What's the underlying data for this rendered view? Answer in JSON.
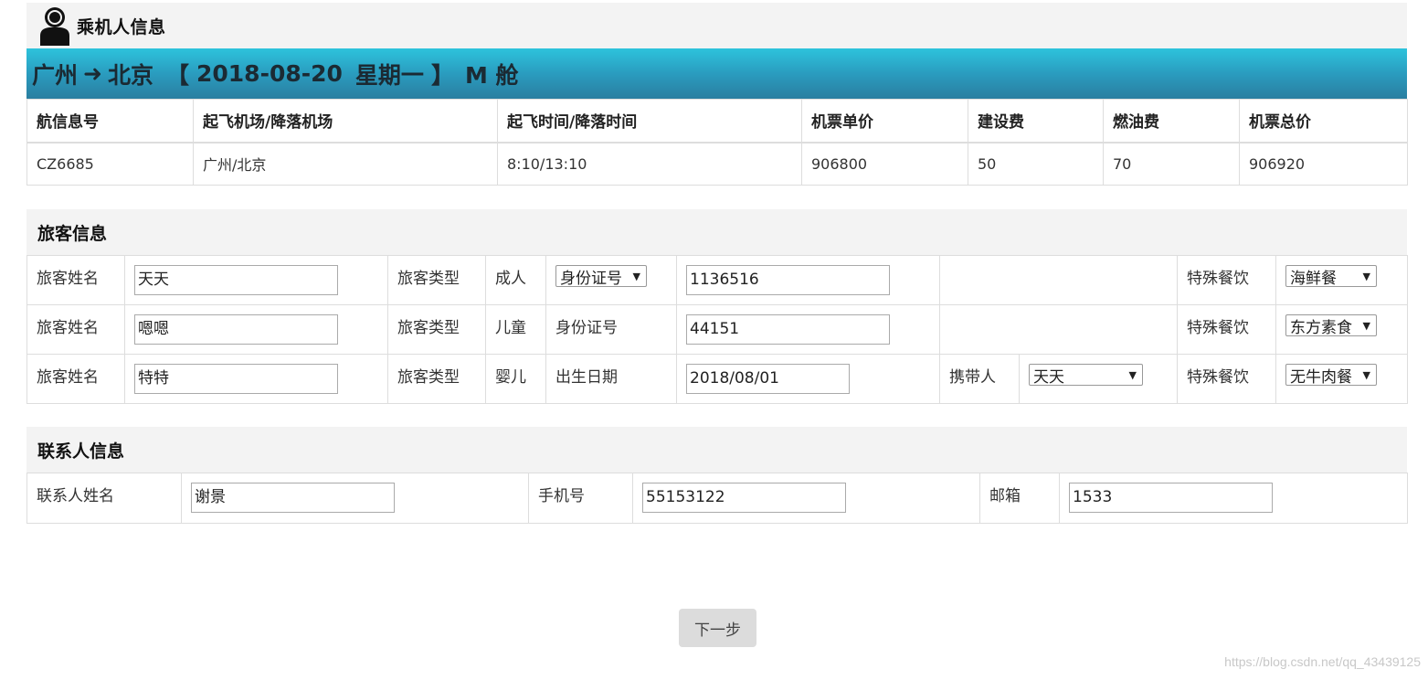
{
  "header": {
    "title": "乘机人信息",
    "icon": "user-icon"
  },
  "route": {
    "from": "广州",
    "arrow": "➜",
    "to": "北京",
    "date_open": "【",
    "date": "2018-08-20",
    "weekday": "星期一",
    "date_close": "】",
    "cabin": "M 舱"
  },
  "flight_table": {
    "headers": [
      "航信息号",
      "起飞机场/降落机场",
      "起飞时间/降落时间",
      "机票单价",
      "建设费",
      "燃油费",
      "机票总价"
    ],
    "rows": [
      [
        "CZ6685",
        "广州/北京",
        "8:10/13:10",
        "906800",
        "50",
        "70",
        "906920"
      ]
    ]
  },
  "passenger_section": {
    "title": "旅客信息",
    "rows": [
      {
        "name_label": "旅客姓名",
        "name_value": "天天",
        "type_label": "旅客类型",
        "type_value": "成人",
        "id_type": "身份证号",
        "id_value": "1136516",
        "carrier_label": "",
        "carrier_value": "",
        "meal_label": "特殊餐饮",
        "meal_value": "海鲜餐"
      },
      {
        "name_label": "旅客姓名",
        "name_value": "嗯嗯",
        "type_label": "旅客类型",
        "type_value": "儿童",
        "id_type": "身份证号",
        "id_value": "44151",
        "carrier_label": "",
        "carrier_value": "",
        "meal_label": "特殊餐饮",
        "meal_value": "东方素食"
      },
      {
        "name_label": "旅客姓名",
        "name_value": "特特",
        "type_label": "旅客类型",
        "type_value": "婴儿",
        "id_type": "出生日期",
        "id_value": "2018/08/01",
        "carrier_label": "携带人",
        "carrier_value": "天天",
        "meal_label": "特殊餐饮",
        "meal_value": "无牛肉餐"
      }
    ]
  },
  "contact_section": {
    "title": "联系人信息",
    "name_label": "联系人姓名",
    "name_value": "谢景",
    "phone_label": "手机号",
    "phone_value": "55153122",
    "email_label": "邮箱",
    "email_value": "1533"
  },
  "next_button": "下一步",
  "watermark": "https://blog.csdn.net/qq_43439125"
}
